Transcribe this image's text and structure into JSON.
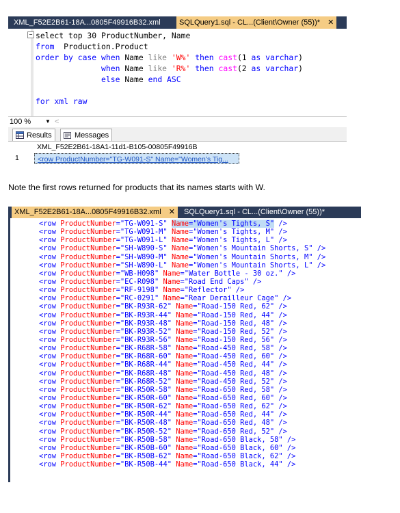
{
  "query_window": {
    "tabs": [
      {
        "label": "XML_F52E2B61-18A...0805F49916B32.xml",
        "active": false
      },
      {
        "label": "SQLQuery1.sql - CL...(Client\\Owner (55))*",
        "active": true
      }
    ],
    "close_glyph": "✕",
    "collapse_glyph": "−",
    "code_lines": [
      [
        {
          "t": "select top 30 ProductNumber, Name",
          "c": ""
        }
      ],
      [
        {
          "t": "from  ",
          "c": "kw"
        },
        {
          "t": "Production.Product",
          "c": ""
        }
      ],
      [
        {
          "t": "order by case when ",
          "c": "kw"
        },
        {
          "t": "Name ",
          "c": ""
        },
        {
          "t": "like ",
          "c": "gr"
        },
        {
          "t": "'W%'",
          "c": "str"
        },
        {
          "t": " then ",
          "c": "kw"
        },
        {
          "t": "cast",
          "c": "fn"
        },
        {
          "t": "(1 ",
          "c": ""
        },
        {
          "t": "as varchar",
          "c": "kw"
        },
        {
          "t": ")",
          "c": ""
        }
      ],
      [
        {
          "t": "              when ",
          "c": "kw"
        },
        {
          "t": "Name ",
          "c": ""
        },
        {
          "t": "like ",
          "c": "gr"
        },
        {
          "t": "'R%'",
          "c": "str"
        },
        {
          "t": " then ",
          "c": "kw"
        },
        {
          "t": "cast",
          "c": "fn"
        },
        {
          "t": "(2 ",
          "c": ""
        },
        {
          "t": "as varchar",
          "c": "kw"
        },
        {
          "t": ")",
          "c": ""
        }
      ],
      [
        {
          "t": "              else ",
          "c": "kw"
        },
        {
          "t": "Name ",
          "c": ""
        },
        {
          "t": "end ASC",
          "c": "kw"
        }
      ],
      [
        {
          "t": "",
          "c": ""
        }
      ],
      [
        {
          "t": "for xml raw",
          "c": "kw"
        }
      ]
    ],
    "zoom_value": "100 %",
    "zoom_dropdown_glyph": "▼",
    "zoom_left_glyph": "<",
    "result_tabs": [
      {
        "label": "Results",
        "icon": "grid-icon"
      },
      {
        "label": "Messages",
        "icon": "messages-icon"
      }
    ],
    "grid_header": "XML_F52E2B61-18A1-11d1-B105-00805F49916B",
    "grid_row_number": "1",
    "grid_cell": "<row ProductNumber=\"TG-W091-S\" Name=\"Women's Tig..."
  },
  "note_text": "Note the first rows returned for products that its names starts with W.",
  "xml_window": {
    "tabs": [
      {
        "label": "XML_F52E2B61-18A...0805F49916B32.xml",
        "active": true
      },
      {
        "label": "SQLQuery1.sql - CL...(Client\\Owner (55))*",
        "active": false
      }
    ],
    "close_glyph": "✕",
    "rows": [
      {
        "pn": "TG-W091-S",
        "name": "Women's Tights, S"
      },
      {
        "pn": "TG-W091-M",
        "name": "Women's Tights, M"
      },
      {
        "pn": "TG-W091-L",
        "name": "Women's Tights, L"
      },
      {
        "pn": "SH-W890-S",
        "name": "Women's Mountain Shorts, S"
      },
      {
        "pn": "SH-W890-M",
        "name": "Women's Mountain Shorts, M"
      },
      {
        "pn": "SH-W890-L",
        "name": "Women's Mountain Shorts, L"
      },
      {
        "pn": "WB-H098",
        "name": "Water Bottle - 30 oz."
      },
      {
        "pn": "EC-R098",
        "name": "Road End Caps"
      },
      {
        "pn": "RF-9198",
        "name": "Reflector"
      },
      {
        "pn": "RC-0291",
        "name": "Rear Derailleur Cage"
      },
      {
        "pn": "BK-R93R-62",
        "name": "Road-150 Red, 62"
      },
      {
        "pn": "BK-R93R-44",
        "name": "Road-150 Red, 44"
      },
      {
        "pn": "BK-R93R-48",
        "name": "Road-150 Red, 48"
      },
      {
        "pn": "BK-R93R-52",
        "name": "Road-150 Red, 52"
      },
      {
        "pn": "BK-R93R-56",
        "name": "Road-150 Red, 56"
      },
      {
        "pn": "BK-R68R-58",
        "name": "Road-450 Red, 58"
      },
      {
        "pn": "BK-R68R-60",
        "name": "Road-450 Red, 60"
      },
      {
        "pn": "BK-R68R-44",
        "name": "Road-450 Red, 44"
      },
      {
        "pn": "BK-R68R-48",
        "name": "Road-450 Red, 48"
      },
      {
        "pn": "BK-R68R-52",
        "name": "Road-450 Red, 52"
      },
      {
        "pn": "BK-R50R-58",
        "name": "Road-650 Red, 58"
      },
      {
        "pn": "BK-R50R-60",
        "name": "Road-650 Red, 60"
      },
      {
        "pn": "BK-R50R-62",
        "name": "Road-650 Red, 62"
      },
      {
        "pn": "BK-R50R-44",
        "name": "Road-650 Red, 44"
      },
      {
        "pn": "BK-R50R-48",
        "name": "Road-650 Red, 48"
      },
      {
        "pn": "BK-R50R-52",
        "name": "Road-650 Red, 52"
      },
      {
        "pn": "BK-R50B-58",
        "name": "Road-650 Black, 58"
      },
      {
        "pn": "BK-R50B-60",
        "name": "Road-650 Black, 60"
      },
      {
        "pn": "BK-R50B-62",
        "name": "Road-650 Black, 62"
      },
      {
        "pn": "BK-R50B-44",
        "name": "Road-650 Black, 44"
      }
    ]
  },
  "colors": {
    "tab_bar": "#2b3b58",
    "active_tab": "#f5cc84",
    "keyword": "#0000ff",
    "function": "#ff00ff",
    "string": "#ff0000",
    "xml_attr": "#ff0000",
    "xml_tag": "#0000ff",
    "selection": "#c0dcf5"
  }
}
